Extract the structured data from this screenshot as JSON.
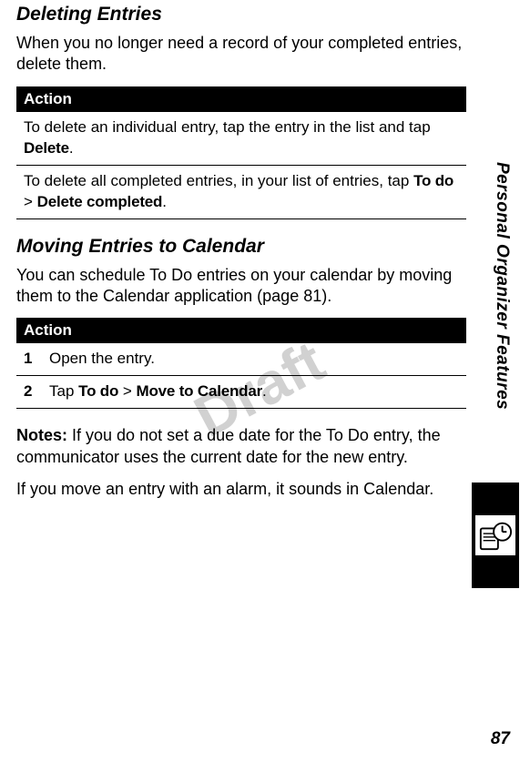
{
  "headings": {
    "deleting": "Deleting Entries",
    "moving": "Moving Entries to Calendar"
  },
  "paragraphs": {
    "deleting_intro": "When you no longer need a record of your completed entries, delete them.",
    "moving_intro": "You can schedule To Do entries on your calendar by moving them to the Calendar application (page 81).",
    "notes_label": "Notes:",
    "notes_body": " If you do not set a due date for the To Do entry, the communicator uses the current date for the new entry.",
    "alarm_body": "If you move an entry with an alarm, it sounds in Calendar."
  },
  "action_label": "Action",
  "deleting_steps": {
    "row1_pre": "To delete an individual entry, tap the entry in the list and tap ",
    "row1_b1": "Delete",
    "row1_post": ".",
    "row2_pre": "To delete all completed entries, in your list of entries, tap ",
    "row2_b1": "To do",
    "row2_sep": " >  ",
    "row2_b2": "Delete completed",
    "row2_post": "."
  },
  "moving_steps": {
    "n1": "1",
    "s1": "Open the entry.",
    "n2": "2",
    "s2_pre": "Tap ",
    "s2_b1": "To do",
    "s2_sep": " > ",
    "s2_b2": "Move to Calendar",
    "s2_post": "."
  },
  "sidebar": "Personal Organizer Features",
  "page_number": "87",
  "watermark": "Draft"
}
